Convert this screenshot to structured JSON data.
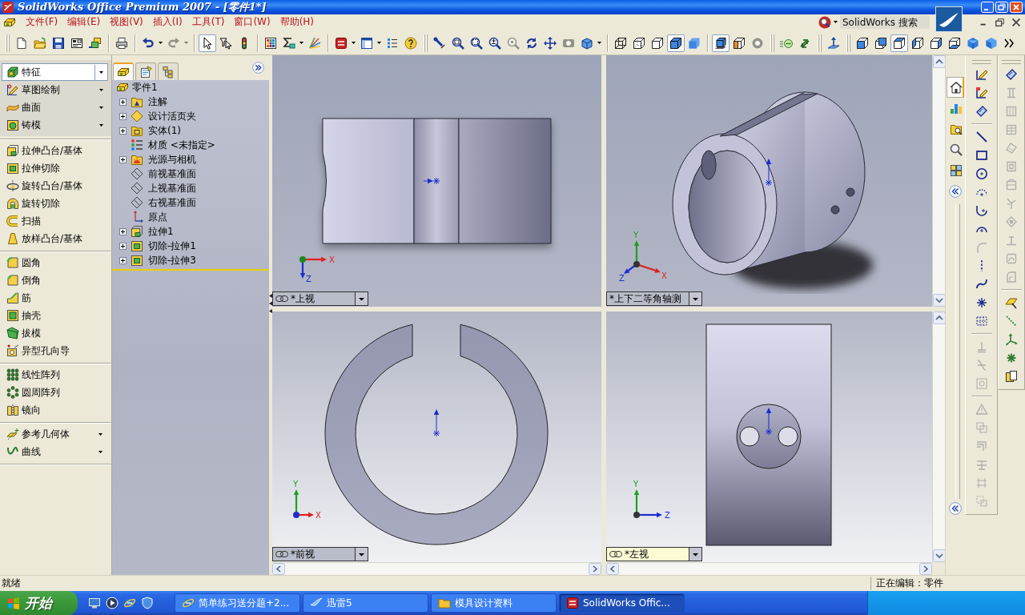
{
  "window": {
    "title": "SolidWorks Office Premium 2007 - [零件1*]"
  },
  "menu": [
    "文件(F)",
    "编辑(E)",
    "视图(V)",
    "插入(I)",
    "工具(T)",
    "窗口(W)",
    "帮助(H)"
  ],
  "search": {
    "placeholder": "SolidWorks 搜索"
  },
  "toolbar": [
    {
      "pressed": false,
      "disabled": false
    },
    {
      "pressed": false,
      "disabled": false
    },
    {
      "pressed": false,
      "disabled": false
    },
    {
      "pressed": false,
      "disabled": false
    },
    {
      "pressed": false,
      "disabled": false
    },
    {
      "pressed": false,
      "disabled": false
    },
    {
      "pressed": false,
      "disabled": false
    },
    {
      "pressed": false,
      "disabled": true
    },
    {
      "pressed": true,
      "disabled": false
    },
    {
      "pressed": false,
      "disabled": false
    },
    {
      "pressed": false,
      "disabled": false
    },
    {
      "pressed": false,
      "disabled": false
    },
    {
      "pressed": false,
      "disabled": false
    },
    {
      "pressed": false,
      "disabled": false
    },
    {
      "pressed": false,
      "disabled": false
    },
    {
      "pressed": false,
      "disabled": false
    },
    {
      "pressed": false,
      "disabled": false
    },
    {
      "pressed": false,
      "disabled": false
    },
    {
      "pressed": false,
      "disabled": false
    },
    {
      "pressed": false,
      "disabled": false
    },
    {
      "pressed": false,
      "disabled": false
    },
    {
      "pressed": false,
      "disabled": false
    },
    {
      "pressed": false,
      "disabled": true
    },
    {
      "pressed": false,
      "disabled": false
    },
    {
      "pressed": false,
      "disabled": false
    },
    {
      "pressed": false,
      "disabled": true
    },
    {
      "pressed": false,
      "disabled": false
    },
    {
      "pressed": false,
      "disabled": false
    },
    {
      "pressed": false,
      "disabled": false
    },
    {
      "pressed": false,
      "disabled": false
    },
    {
      "pressed": true,
      "disabled": false
    },
    {
      "pressed": false,
      "disabled": false
    },
    {
      "pressed": true,
      "disabled": false
    },
    {
      "pressed": false,
      "disabled": false
    },
    {
      "pressed": false,
      "disabled": true
    },
    {
      "pressed": false,
      "disabled": false
    },
    {
      "pressed": false,
      "disabled": false
    },
    {
      "pressed": false,
      "disabled": false
    },
    {
      "pressed": false,
      "disabled": false
    },
    {
      "pressed": false,
      "disabled": false
    },
    {
      "pressed": true,
      "disabled": false
    },
    {
      "pressed": false,
      "disabled": false
    },
    {
      "pressed": false,
      "disabled": false
    },
    {
      "pressed": false,
      "disabled": false
    },
    {
      "pressed": false,
      "disabled": false
    },
    {
      "pressed": false,
      "disabled": false
    },
    {
      "pressed": false,
      "disabled": false
    }
  ],
  "command_manager": {
    "toolbars": [
      {
        "label": "特征",
        "selected": true
      },
      {
        "label": "草图绘制",
        "selected": false
      },
      {
        "label": "曲面",
        "selected": false
      },
      {
        "label": "铸模",
        "selected": false
      }
    ],
    "groups": [
      [
        "拉伸凸台/基体",
        "拉伸切除",
        "旋转凸台/基体",
        "旋转切除",
        "扫描",
        "放样凸台/基体"
      ],
      [
        "圆角",
        "倒角",
        "筋",
        "抽壳",
        "拔模",
        "异型孔向导"
      ],
      [
        "线性阵列",
        "圆周阵列",
        "镜向"
      ]
    ],
    "flyouts": [
      "参考几何体",
      "曲线"
    ]
  },
  "feature_tree": {
    "tabs": [
      {
        "selected": true
      },
      {
        "selected": false
      },
      {
        "selected": false
      }
    ],
    "root": {
      "label": "零件1",
      "children": [
        {
          "label": "注解",
          "kind": "annotations",
          "expanded": false
        },
        {
          "label": "设计活页夹",
          "kind": "binder",
          "expanded": false
        },
        {
          "label": "实体(1)",
          "kind": "solids",
          "expanded": false
        },
        {
          "label": "材质 <未指定>",
          "kind": "material"
        },
        {
          "label": "光源与相机",
          "kind": "lights",
          "expanded": false
        },
        {
          "label": "前视基准面",
          "kind": "plane"
        },
        {
          "label": "上视基准面",
          "kind": "plane"
        },
        {
          "label": "右视基准面",
          "kind": "plane"
        },
        {
          "label": "原点",
          "kind": "origin"
        },
        {
          "label": "拉伸1",
          "kind": "extrude",
          "expanded": false
        },
        {
          "label": "切除-拉伸1",
          "kind": "cut",
          "expanded": false
        },
        {
          "label": "切除-拉伸3",
          "kind": "cut",
          "expanded": false
        }
      ]
    }
  },
  "viewports": [
    {
      "view": "*上视",
      "linked": true,
      "selected": false,
      "axes": [
        "X",
        "Z"
      ]
    },
    {
      "view": "*上下二等角轴测",
      "linked": false,
      "selected": false,
      "axes": [
        "Y",
        "Z",
        "X"
      ]
    },
    {
      "view": "*前视",
      "linked": true,
      "selected": false,
      "axes": [
        "Y",
        "X"
      ]
    },
    {
      "view": "*左视",
      "linked": true,
      "selected": true,
      "axes": [
        "Y",
        "Z"
      ]
    }
  ],
  "task_pane": [
    {
      "selected": true
    },
    {
      "selected": false
    },
    {
      "selected": false
    },
    {
      "selected": false
    },
    {
      "selected": false
    }
  ],
  "sketch_toolbar": [
    {
      "disabled": false
    },
    {
      "disabled": false
    },
    {
      "disabled": false
    },
    {
      "disabled": false
    },
    {
      "disabled": false
    },
    {
      "disabled": false
    },
    {
      "disabled": false
    },
    {
      "disabled": false
    },
    {
      "disabled": false
    },
    {
      "disabled": true
    },
    {
      "disabled": false
    },
    {
      "disabled": false
    },
    {
      "disabled": false
    },
    {
      "disabled": false
    },
    {
      "disabled": true
    },
    {
      "disabled": true
    },
    {
      "disabled": true
    },
    {
      "disabled": true
    },
    {
      "disabled": true
    },
    {
      "disabled": true
    },
    {
      "disabled": true
    },
    {
      "disabled": true
    },
    {
      "disabled": true
    }
  ],
  "reference_toolbar": [
    {
      "disabled": false
    },
    {
      "disabled": true
    },
    {
      "disabled": true
    },
    {
      "disabled": true
    },
    {
      "disabled": true
    },
    {
      "disabled": true
    },
    {
      "disabled": true
    },
    {
      "disabled": true
    },
    {
      "disabled": true
    },
    {
      "disabled": true
    },
    {
      "disabled": true
    },
    {
      "disabled": true
    },
    {
      "disabled": false
    },
    {
      "disabled": false
    },
    {
      "disabled": false
    },
    {
      "disabled": false
    },
    {
      "disabled": false
    }
  ],
  "status_bar": {
    "message": "就绪",
    "mode": "正在编辑：零件"
  },
  "taskbar": {
    "start": "开始",
    "tasks": [
      {
        "label": "简单练习送分题+2...",
        "selected": false
      },
      {
        "label": "迅雷5",
        "selected": false
      },
      {
        "label": "模具设计资料",
        "selected": false
      },
      {
        "label": "SolidWorks Offic...",
        "selected": true
      }
    ]
  }
}
